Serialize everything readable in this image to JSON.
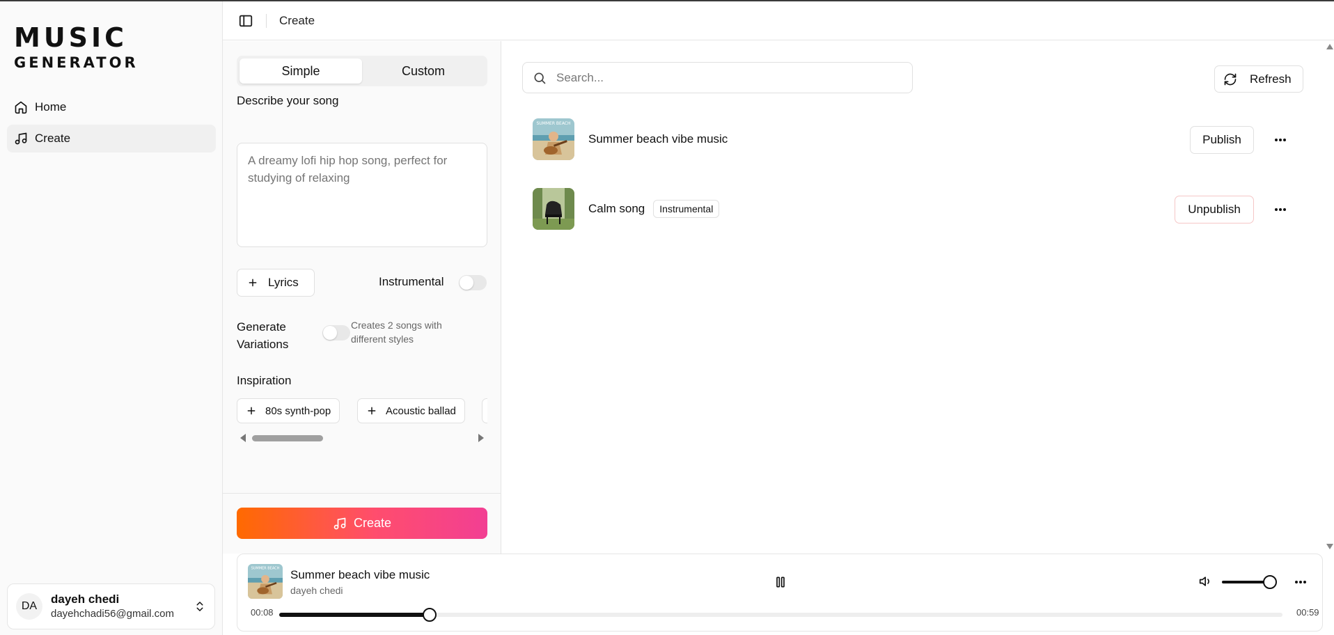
{
  "app": {
    "logo_line1": "MUSIC",
    "logo_line2": "GENERATOR"
  },
  "sidebar": {
    "items": [
      {
        "label": "Home",
        "icon": "home-icon",
        "active": false
      },
      {
        "label": "Create",
        "icon": "music-note-icon",
        "active": true
      }
    ]
  },
  "user": {
    "initials": "DA",
    "name": "dayeh chedi",
    "email": "dayehchadi56@gmail.com"
  },
  "topbar": {
    "title": "Create"
  },
  "form": {
    "tabs": [
      {
        "label": "Simple",
        "active": true
      },
      {
        "label": "Custom",
        "active": false
      }
    ],
    "describe_label": "Describe your song",
    "describe_placeholder": "A dreamy lofi hip hop song, perfect for studying of relaxing",
    "lyrics_button": "Lyrics",
    "instrumental_label": "Instrumental",
    "instrumental_on": false,
    "variations_label_line1": "Generate",
    "variations_label_line2": "Variations",
    "variations_hint_line1": "Creates 2 songs with",
    "variations_hint_line2": "different styles",
    "variations_on": false,
    "inspiration_label": "Inspiration",
    "inspiration_chips": [
      "80s synth-pop",
      "Acoustic ballad"
    ],
    "create_button": "Create"
  },
  "library": {
    "search_placeholder": "Search...",
    "refresh_label": "Refresh",
    "songs": [
      {
        "title": "Summer beach vibe music",
        "badge": "",
        "action": "Publish",
        "thumb_icon": "beach-guitar-thumbnail",
        "thumb_text": "SUMMER BEACH"
      },
      {
        "title": "Calm song",
        "badge": "Instrumental",
        "action": "Unpublish",
        "thumb_icon": "piano-forest-thumbnail",
        "thumb_text": ""
      }
    ]
  },
  "player": {
    "title": "Summer beach vibe music",
    "artist": "dayeh chedi",
    "current_time": "00:08",
    "total_time": "00:59",
    "progress": 0.15,
    "volume": 0.85
  },
  "colors": {
    "accent_start": "#ff6a00",
    "accent_end": "#f23f93",
    "unpublish_border": "#f5c6c6"
  }
}
